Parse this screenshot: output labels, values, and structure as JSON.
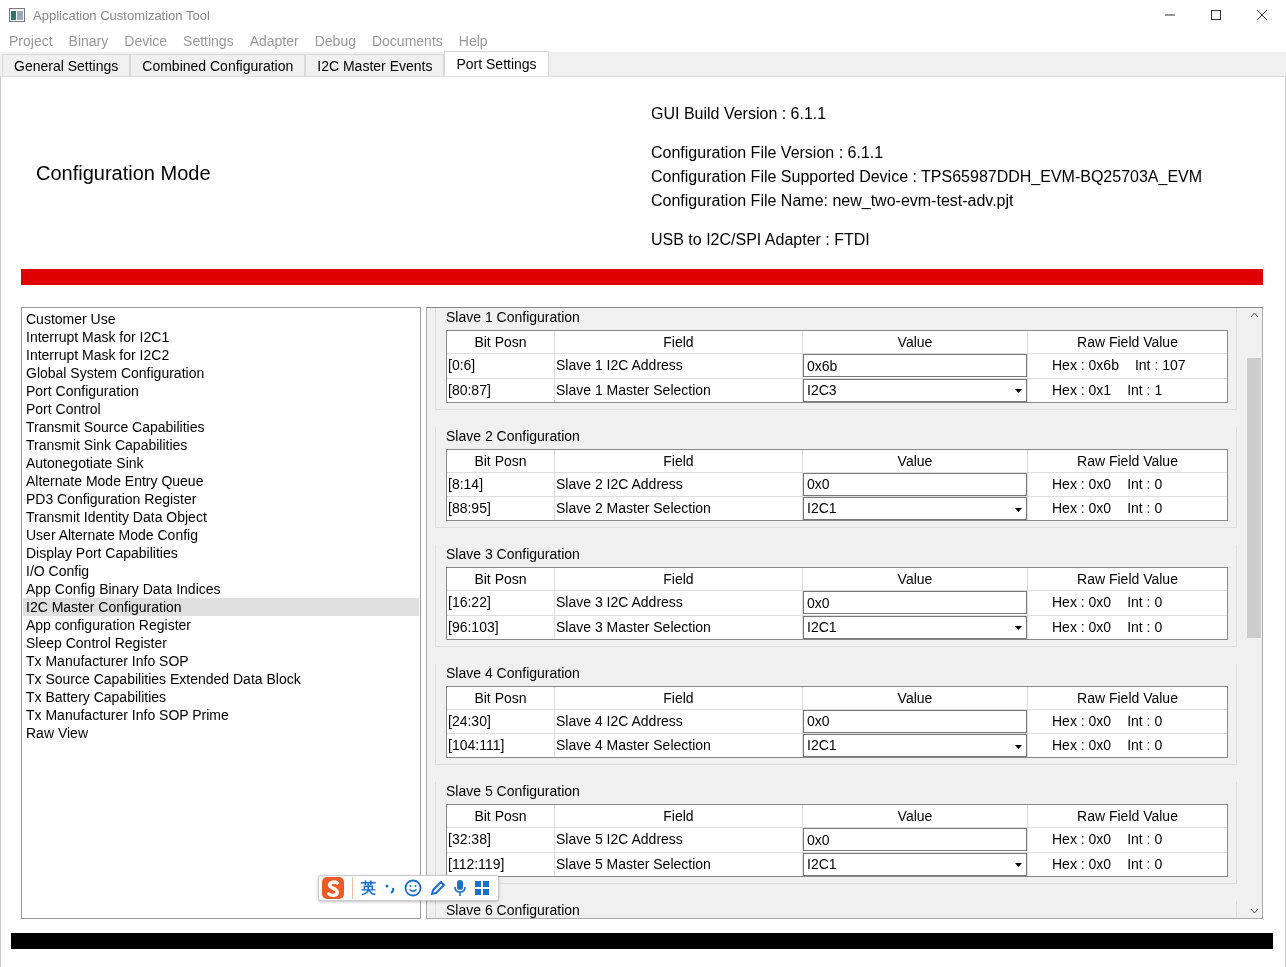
{
  "window": {
    "title": "Application Customization Tool"
  },
  "menu": [
    "Project",
    "Binary",
    "Device",
    "Settings",
    "Adapter",
    "Debug",
    "Documents",
    "Help"
  ],
  "tabs": [
    {
      "label": "General Settings",
      "selected": false
    },
    {
      "label": "Combined Configuration",
      "selected": false
    },
    {
      "label": "I2C Master Events",
      "selected": false
    },
    {
      "label": "Port Settings",
      "selected": true
    }
  ],
  "header": {
    "mode": "Configuration Mode",
    "info": [
      [
        "GUI Build Version : 6.1.1"
      ],
      [
        "Configuration File Version : 6.1.1",
        "Configuration File Supported Device : TPS65987DDH_EVM-BQ25703A_EVM",
        "Configuration File Name: new_two-evm-test-adv.pjt"
      ],
      [
        "USB to I2C/SPI Adapter : FTDI"
      ]
    ]
  },
  "sidebar": {
    "items": [
      {
        "label": "Customer Use",
        "selected": false
      },
      {
        "label": "Interrupt Mask for I2C1",
        "selected": false
      },
      {
        "label": "Interrupt Mask for I2C2",
        "selected": false
      },
      {
        "label": "Global System Configuration",
        "selected": false
      },
      {
        "label": "Port Configuration",
        "selected": false
      },
      {
        "label": "Port Control",
        "selected": false
      },
      {
        "label": "Transmit Source Capabilities",
        "selected": false
      },
      {
        "label": "Transmit Sink Capabilities",
        "selected": false
      },
      {
        "label": "Autonegotiate Sink",
        "selected": false
      },
      {
        "label": "Alternate Mode Entry Queue",
        "selected": false
      },
      {
        "label": "PD3 Configuration Register",
        "selected": false
      },
      {
        "label": "Transmit Identity Data Object",
        "selected": false
      },
      {
        "label": "User Alternate Mode Config",
        "selected": false
      },
      {
        "label": "Display Port Capabilities",
        "selected": false
      },
      {
        "label": "I/O Config",
        "selected": false
      },
      {
        "label": "App Config Binary Data Indices",
        "selected": false
      },
      {
        "label": "I2C Master Configuration",
        "selected": true
      },
      {
        "label": "App configuration Register",
        "selected": false
      },
      {
        "label": "Sleep Control Register",
        "selected": false
      },
      {
        "label": "Tx Manufacturer Info SOP",
        "selected": false
      },
      {
        "label": "Tx Source Capabilities Extended Data Block",
        "selected": false
      },
      {
        "label": "Tx Battery Capabilities",
        "selected": false
      },
      {
        "label": "Tx Manufacturer Info SOP Prime",
        "selected": false
      },
      {
        "label": "Raw View",
        "selected": false
      }
    ]
  },
  "groups": [
    {
      "title": "Slave 1 Configuration",
      "columns": [
        "Bit Posn",
        "Field",
        "Value",
        "Raw Field Value"
      ],
      "rows": [
        {
          "kind": "text",
          "bits": "[0:6]",
          "field": "Slave 1 I2C Address",
          "value": "0x6b",
          "hex": "Hex : 0x6b",
          "int": "Int : 107"
        },
        {
          "kind": "select",
          "bits": "[80:87]",
          "field": "Slave 1 Master Selection",
          "value": "I2C3",
          "hex": "Hex : 0x1",
          "int": "Int : 1"
        }
      ]
    },
    {
      "title": "Slave 2 Configuration",
      "columns": [
        "Bit Posn",
        "Field",
        "Value",
        "Raw Field Value"
      ],
      "rows": [
        {
          "kind": "text",
          "bits": "[8:14]",
          "field": "Slave 2 I2C Address",
          "value": "0x0",
          "hex": "Hex : 0x0",
          "int": "Int : 0"
        },
        {
          "kind": "select",
          "bits": "[88:95]",
          "field": "Slave 2 Master Selection",
          "value": "I2C1",
          "hex": "Hex : 0x0",
          "int": "Int : 0"
        }
      ]
    },
    {
      "title": "Slave 3 Configuration",
      "columns": [
        "Bit Posn",
        "Field",
        "Value",
        "Raw Field Value"
      ],
      "rows": [
        {
          "kind": "text",
          "bits": "[16:22]",
          "field": "Slave 3 I2C Address",
          "value": "0x0",
          "hex": "Hex : 0x0",
          "int": "Int : 0"
        },
        {
          "kind": "select",
          "bits": "[96:103]",
          "field": "Slave 3 Master Selection",
          "value": "I2C1",
          "hex": "Hex : 0x0",
          "int": "Int : 0"
        }
      ]
    },
    {
      "title": "Slave 4 Configuration",
      "columns": [
        "Bit Posn",
        "Field",
        "Value",
        "Raw Field Value"
      ],
      "rows": [
        {
          "kind": "text",
          "bits": "[24:30]",
          "field": "Slave 4 I2C Address",
          "value": "0x0",
          "hex": "Hex : 0x0",
          "int": "Int : 0"
        },
        {
          "kind": "select",
          "bits": "[104:111]",
          "field": "Slave 4 Master Selection",
          "value": "I2C1",
          "hex": "Hex : 0x0",
          "int": "Int : 0"
        }
      ]
    },
    {
      "title": "Slave 5 Configuration",
      "columns": [
        "Bit Posn",
        "Field",
        "Value",
        "Raw Field Value"
      ],
      "rows": [
        {
          "kind": "text",
          "bits": "[32:38]",
          "field": "Slave 5 I2C Address",
          "value": "0x0",
          "hex": "Hex : 0x0",
          "int": "Int : 0"
        },
        {
          "kind": "select",
          "bits": "[112:119]",
          "field": "Slave 5 Master Selection",
          "value": "I2C1",
          "hex": "Hex : 0x0",
          "int": "Int : 0"
        }
      ]
    },
    {
      "title": "Slave 6 Configuration"
    }
  ],
  "ime": {
    "mode": "英"
  }
}
